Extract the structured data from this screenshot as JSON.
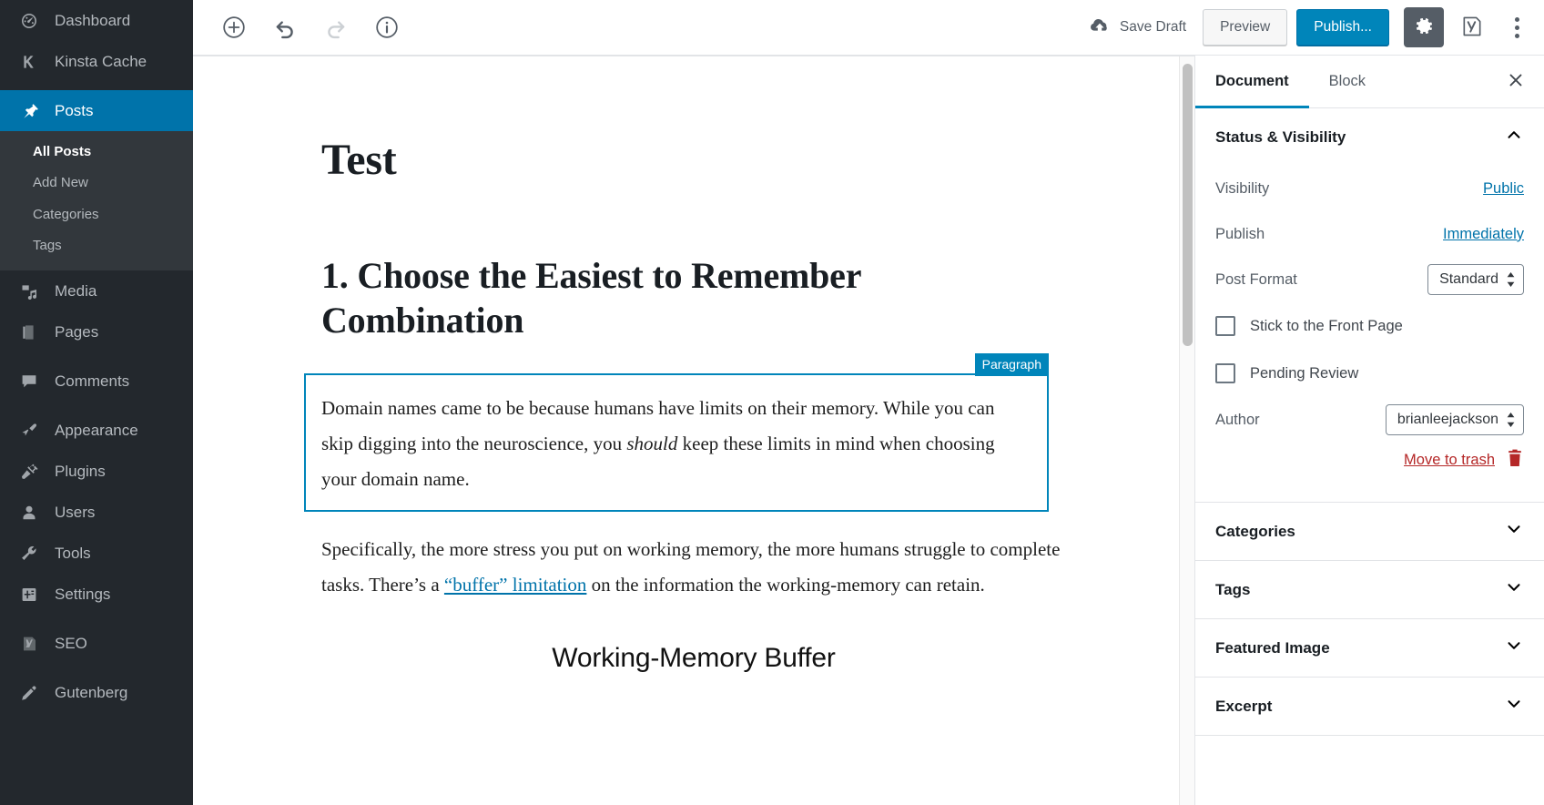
{
  "admin_menu": {
    "items": [
      {
        "label": "Dashboard",
        "icon": "dashboard-icon",
        "current": false,
        "submenu": []
      },
      {
        "label": "Kinsta Cache",
        "icon": "kinsta-k-icon",
        "current": false,
        "submenu": []
      },
      {
        "label": "Posts",
        "icon": "pin-icon",
        "current": true,
        "submenu": [
          {
            "label": "All Posts",
            "current": true
          },
          {
            "label": "Add New",
            "current": false
          },
          {
            "label": "Categories",
            "current": false
          },
          {
            "label": "Tags",
            "current": false
          }
        ]
      },
      {
        "label": "Media",
        "icon": "media-icon",
        "current": false,
        "submenu": []
      },
      {
        "label": "Pages",
        "icon": "pages-icon",
        "current": false,
        "submenu": []
      },
      {
        "label": "Comments",
        "icon": "comment-bubble-icon",
        "current": false,
        "submenu": []
      },
      {
        "label": "Appearance",
        "icon": "paintbrush-icon",
        "current": false,
        "submenu": []
      },
      {
        "label": "Plugins",
        "icon": "plug-icon",
        "current": false,
        "submenu": []
      },
      {
        "label": "Users",
        "icon": "user-icon",
        "current": false,
        "submenu": []
      },
      {
        "label": "Tools",
        "icon": "wrench-icon",
        "current": false,
        "submenu": []
      },
      {
        "label": "Settings",
        "icon": "sliders-icon",
        "current": false,
        "submenu": []
      },
      {
        "label": "SEO",
        "icon": "yoast-y-icon",
        "current": false,
        "submenu": []
      },
      {
        "label": "Gutenberg",
        "icon": "pencil-icon",
        "current": false,
        "submenu": []
      }
    ]
  },
  "header": {
    "add_block_icon": "circle-plus-icon",
    "undo_icon": "undo-arrow-icon",
    "redo_icon": "redo-arrow-icon",
    "info_icon": "info-circle-icon",
    "save_draft_label": "Save Draft",
    "save_draft_icon": "cloud-upload-icon",
    "preview_label": "Preview",
    "publish_label": "Publish...",
    "settings_gear_icon": "gear-icon",
    "yoast_icon": "yoast-seo-icon",
    "more_menu_icon": "vertical-ellipsis-icon"
  },
  "editor": {
    "post_title": "Test",
    "heading": "1. Choose the Easiest to Remember Combination",
    "selected_block": {
      "label": "Paragraph",
      "text_1": "Domain names came to be because humans have limits on their memory. While you can skip digging into the neuroscience, you ",
      "emphasis": "should",
      "text_2": " keep these limits in mind when choosing your domain name."
    },
    "paragraph_2": {
      "text_1": "Specifically, the more stress you put on working memory, the more humans struggle to complete tasks. There’s a ",
      "link_text": "“buffer” limitation",
      "text_2": " on the information the working-memory can retain."
    },
    "image_caption": "Working-Memory Buffer"
  },
  "settings": {
    "tabs": [
      {
        "label": "Document",
        "active": true
      },
      {
        "label": "Block",
        "active": false
      }
    ],
    "close_icon": "close-icon",
    "status_panel": {
      "title": "Status & Visibility",
      "toggle_icon": "chevron-up-icon",
      "visibility_label": "Visibility",
      "visibility_value": "Public",
      "publish_label": "Publish",
      "publish_value": "Immediately",
      "post_format_label": "Post Format",
      "post_format_value": "Standard",
      "sticky_label": "Stick to the Front Page",
      "sticky_checked": false,
      "pending_label": "Pending Review",
      "pending_checked": false,
      "author_label": "Author",
      "author_value": "brianleejackson",
      "trash_label": "Move to trash",
      "trash_icon": "trash-icon"
    },
    "panels": [
      {
        "title": "Categories",
        "toggle_icon": "chevron-down-icon"
      },
      {
        "title": "Tags",
        "toggle_icon": "chevron-down-icon"
      },
      {
        "title": "Featured Image",
        "toggle_icon": "chevron-down-icon"
      },
      {
        "title": "Excerpt",
        "toggle_icon": "chevron-down-icon"
      }
    ]
  },
  "colors": {
    "admin_bg": "#23282d",
    "admin_submenu_bg": "#32373c",
    "accent_blue": "#0085ba",
    "link_blue": "#0073aa",
    "danger_red": "#b52727",
    "gear_bg": "#555d66"
  }
}
